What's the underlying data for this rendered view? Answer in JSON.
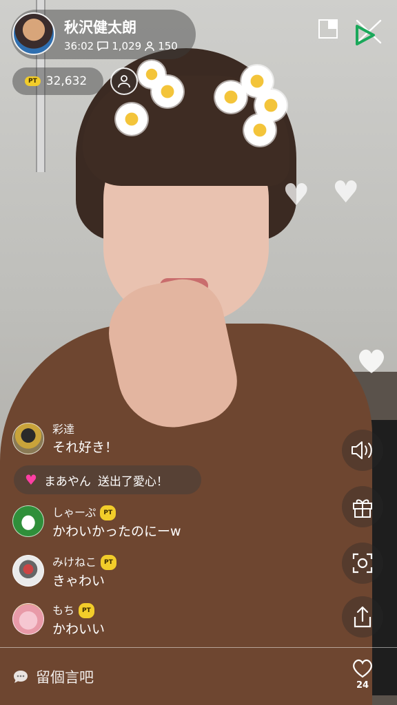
{
  "host": {
    "name": "秋沢健太朗",
    "elapsed": "36:02",
    "comments_count": "1,029",
    "viewers_count": "150",
    "points": "32,632",
    "pt_badge": "PT"
  },
  "comments": [
    {
      "user": "彩達",
      "text": "それ好き！",
      "pt": false,
      "avatar_color": "#7a6a3a"
    },
    {
      "user": "しゃーぷ",
      "text": "かわいかったのにーw",
      "pt": true,
      "pt_label": "PT",
      "avatar_color": "#2f8f3a"
    },
    {
      "user": "みけねこ",
      "text": "きゃわい",
      "pt": true,
      "pt_label": "PT",
      "avatar_color": "#d9d9d9"
    },
    {
      "user": "もち",
      "text": "かわいい",
      "pt": true,
      "pt_label": "PT",
      "avatar_color": "#e8a0b0"
    }
  ],
  "gift_notice": {
    "user": "まあやん",
    "text": "送出了愛心！",
    "heart_color": "#ff3fa4"
  },
  "input": {
    "placeholder": "留個言吧"
  },
  "likes": {
    "count": "24"
  },
  "icons": {
    "top": [
      "pip-icon",
      "close-icon",
      "logo-icon",
      "follow-icon",
      "comment-icon",
      "viewer-icon"
    ],
    "rail": [
      "speaker-icon",
      "gift-icon",
      "camera-icon",
      "share-icon",
      "like-icon"
    ]
  },
  "colors": {
    "pt_yellow": "#f2cd2a",
    "logo_green": "#1aa85a"
  }
}
